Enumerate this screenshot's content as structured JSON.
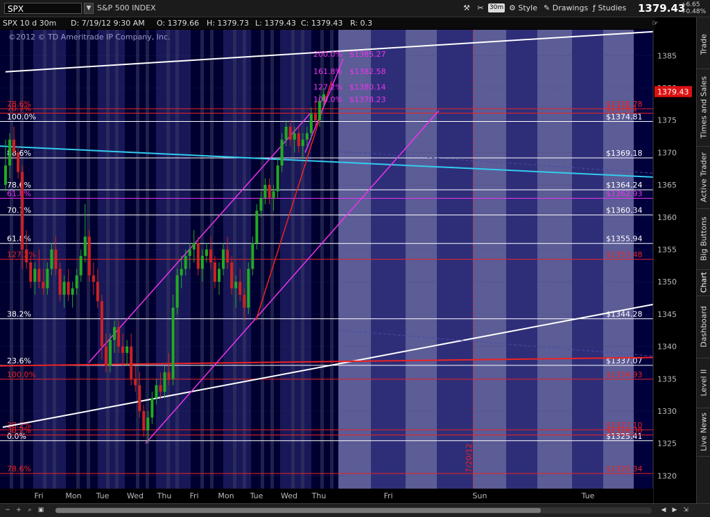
{
  "topbar": {
    "symbol": "SPX",
    "symbol_dropdown_icon": "chevron-down-icon",
    "instrument_name": "S&P 500 INDEX",
    "aggregation": "30m",
    "style_label": "Style",
    "drawings_label": "Drawings",
    "studies_label": "Studies",
    "last_price": "1379.43",
    "change_abs": "+6.65",
    "change_pct": "+0.48%"
  },
  "infobar": {
    "title": "SPX 10 d 30m",
    "date": "D: 7/19/12 9:30 AM",
    "open": "O: 1379.66",
    "high": "H: 1379.73",
    "low": "L: 1379.43",
    "close": "C: 1379.43",
    "range": "R: 0.3",
    "copyright": "©2012 © TD Ameritrade IP Company, Inc."
  },
  "right_tabs": [
    "Trade",
    "Times and Sales",
    "Active Trader",
    "Big Buttons",
    "Chart",
    "Dashboard",
    "Level II",
    "Live News"
  ],
  "colors": {
    "background": "#00003c",
    "band_dark": "#000030",
    "band_light": "#181858",
    "future_dark": "#2e2e78",
    "future_light": "#5c5c96",
    "up": "#22aa22",
    "down": "#cc2222",
    "white_line": "#ffffff",
    "magenta": "#ee33ee",
    "red": "#ee2222",
    "cyan": "#33ccee",
    "price_tag_bg": "#dd1111"
  },
  "chart_data": {
    "type": "candlestick",
    "timeframe": "30m",
    "ylim": [
      1318,
      1389
    ],
    "y_ticks": [
      1320,
      1325,
      1330,
      1335,
      1340,
      1345,
      1350,
      1355,
      1360,
      1365,
      1370,
      1375,
      1380,
      1385
    ],
    "x_labels": [
      "Fri",
      "Mon",
      "Tue",
      "Wed",
      "Thu",
      "Fri",
      "Mon",
      "Tue",
      "Wed",
      "Thu",
      "Fri",
      "Sun",
      "Tue"
    ],
    "date_marker": "7/20/12",
    "last_price_tag": "1379.43",
    "candles": [
      {
        "o": 1365,
        "h": 1372,
        "l": 1364,
        "c": 1368
      },
      {
        "o": 1368,
        "h": 1373,
        "l": 1366,
        "c": 1372
      },
      {
        "o": 1372,
        "h": 1374,
        "l": 1369,
        "c": 1370
      },
      {
        "o": 1370,
        "h": 1371,
        "l": 1366,
        "c": 1367
      },
      {
        "o": 1367,
        "h": 1368,
        "l": 1352,
        "c": 1355
      },
      {
        "o": 1355,
        "h": 1358,
        "l": 1352,
        "c": 1353
      },
      {
        "o": 1353,
        "h": 1354,
        "l": 1349,
        "c": 1350
      },
      {
        "o": 1350,
        "h": 1353,
        "l": 1348,
        "c": 1352
      },
      {
        "o": 1352,
        "h": 1355,
        "l": 1349,
        "c": 1350
      },
      {
        "o": 1350,
        "h": 1352,
        "l": 1348,
        "c": 1349
      },
      {
        "o": 1349,
        "h": 1353,
        "l": 1348,
        "c": 1352
      },
      {
        "o": 1352,
        "h": 1356,
        "l": 1351,
        "c": 1355
      },
      {
        "o": 1355,
        "h": 1357,
        "l": 1351,
        "c": 1352
      },
      {
        "o": 1352,
        "h": 1353,
        "l": 1347,
        "c": 1348
      },
      {
        "o": 1348,
        "h": 1351,
        "l": 1346,
        "c": 1350
      },
      {
        "o": 1350,
        "h": 1352,
        "l": 1347,
        "c": 1348
      },
      {
        "o": 1348,
        "h": 1350,
        "l": 1346,
        "c": 1349
      },
      {
        "o": 1349,
        "h": 1352,
        "l": 1348,
        "c": 1351
      },
      {
        "o": 1351,
        "h": 1355,
        "l": 1350,
        "c": 1354
      },
      {
        "o": 1354,
        "h": 1362,
        "l": 1353,
        "c": 1357
      },
      {
        "o": 1357,
        "h": 1358,
        "l": 1350,
        "c": 1351
      },
      {
        "o": 1351,
        "h": 1353,
        "l": 1348,
        "c": 1350
      },
      {
        "o": 1350,
        "h": 1352,
        "l": 1346,
        "c": 1347
      },
      {
        "o": 1347,
        "h": 1348,
        "l": 1338,
        "c": 1340
      },
      {
        "o": 1340,
        "h": 1342,
        "l": 1336,
        "c": 1337
      },
      {
        "o": 1337,
        "h": 1342,
        "l": 1336,
        "c": 1341
      },
      {
        "o": 1341,
        "h": 1344,
        "l": 1339,
        "c": 1343
      },
      {
        "o": 1343,
        "h": 1344,
        "l": 1339,
        "c": 1340
      },
      {
        "o": 1340,
        "h": 1342,
        "l": 1337,
        "c": 1339
      },
      {
        "o": 1339,
        "h": 1341,
        "l": 1337,
        "c": 1340
      },
      {
        "o": 1340,
        "h": 1342,
        "l": 1334,
        "c": 1335
      },
      {
        "o": 1335,
        "h": 1337,
        "l": 1333,
        "c": 1334
      },
      {
        "o": 1334,
        "h": 1336,
        "l": 1329,
        "c": 1330
      },
      {
        "o": 1330,
        "h": 1331,
        "l": 1326,
        "c": 1327
      },
      {
        "o": 1327,
        "h": 1330,
        "l": 1325,
        "c": 1329
      },
      {
        "o": 1329,
        "h": 1333,
        "l": 1328,
        "c": 1332
      },
      {
        "o": 1332,
        "h": 1335,
        "l": 1331,
        "c": 1334
      },
      {
        "o": 1334,
        "h": 1336,
        "l": 1332,
        "c": 1333
      },
      {
        "o": 1333,
        "h": 1337,
        "l": 1332,
        "c": 1336
      },
      {
        "o": 1336,
        "h": 1339,
        "l": 1334,
        "c": 1335
      },
      {
        "o": 1335,
        "h": 1348,
        "l": 1334,
        "c": 1346
      },
      {
        "o": 1346,
        "h": 1352,
        "l": 1345,
        "c": 1351
      },
      {
        "o": 1351,
        "h": 1354,
        "l": 1349,
        "c": 1352
      },
      {
        "o": 1352,
        "h": 1355,
        "l": 1351,
        "c": 1354
      },
      {
        "o": 1354,
        "h": 1356,
        "l": 1352,
        "c": 1355
      },
      {
        "o": 1355,
        "h": 1358,
        "l": 1353,
        "c": 1356
      },
      {
        "o": 1356,
        "h": 1357,
        "l": 1351,
        "c": 1352
      },
      {
        "o": 1352,
        "h": 1355,
        "l": 1350,
        "c": 1354
      },
      {
        "o": 1354,
        "h": 1356,
        "l": 1353,
        "c": 1355
      },
      {
        "o": 1355,
        "h": 1357,
        "l": 1352,
        "c": 1353
      },
      {
        "o": 1353,
        "h": 1354,
        "l": 1349,
        "c": 1350
      },
      {
        "o": 1350,
        "h": 1353,
        "l": 1348,
        "c": 1352
      },
      {
        "o": 1352,
        "h": 1356,
        "l": 1351,
        "c": 1355
      },
      {
        "o": 1355,
        "h": 1357,
        "l": 1352,
        "c": 1353
      },
      {
        "o": 1353,
        "h": 1354,
        "l": 1348,
        "c": 1349
      },
      {
        "o": 1349,
        "h": 1351,
        "l": 1346,
        "c": 1350
      },
      {
        "o": 1350,
        "h": 1352,
        "l": 1347,
        "c": 1348
      },
      {
        "o": 1348,
        "h": 1349,
        "l": 1344,
        "c": 1346
      },
      {
        "o": 1346,
        "h": 1353,
        "l": 1345,
        "c": 1352
      },
      {
        "o": 1352,
        "h": 1357,
        "l": 1351,
        "c": 1356
      },
      {
        "o": 1356,
        "h": 1362,
        "l": 1355,
        "c": 1361
      },
      {
        "o": 1361,
        "h": 1364,
        "l": 1360,
        "c": 1363
      },
      {
        "o": 1363,
        "h": 1366,
        "l": 1362,
        "c": 1365
      },
      {
        "o": 1365,
        "h": 1366,
        "l": 1362,
        "c": 1363
      },
      {
        "o": 1363,
        "h": 1365,
        "l": 1361,
        "c": 1364
      },
      {
        "o": 1364,
        "h": 1369,
        "l": 1363,
        "c": 1368
      },
      {
        "o": 1368,
        "h": 1373,
        "l": 1367,
        "c": 1372
      },
      {
        "o": 1372,
        "h": 1375,
        "l": 1371,
        "c": 1374
      },
      {
        "o": 1374,
        "h": 1375,
        "l": 1371,
        "c": 1372
      },
      {
        "o": 1372,
        "h": 1374,
        "l": 1370,
        "c": 1373
      },
      {
        "o": 1373,
        "h": 1374,
        "l": 1370,
        "c": 1371
      },
      {
        "o": 1371,
        "h": 1373,
        "l": 1369,
        "c": 1372
      },
      {
        "o": 1372,
        "h": 1374,
        "l": 1371,
        "c": 1373
      },
      {
        "o": 1373,
        "h": 1377,
        "l": 1372,
        "c": 1376
      },
      {
        "o": 1376,
        "h": 1378,
        "l": 1374,
        "c": 1375
      },
      {
        "o": 1375,
        "h": 1379,
        "l": 1374,
        "c": 1378
      },
      {
        "o": 1378,
        "h": 1380,
        "l": 1377,
        "c": 1379
      }
    ],
    "horizontal_levels": [
      {
        "price": 1374.81,
        "color": "white",
        "right_label": "$1374.81",
        "left_label": "100.0%"
      },
      {
        "price": 1369.18,
        "color": "white",
        "right_label": "$1369.18",
        "left_label": "88.6%"
      },
      {
        "price": 1364.24,
        "color": "white",
        "right_label": "$1364.24",
        "left_label": "78.6%"
      },
      {
        "price": 1360.34,
        "color": "white",
        "right_label": "$1360.34",
        "left_label": "70.7%"
      },
      {
        "price": 1355.94,
        "color": "white",
        "right_label": "$1355.94",
        "left_label": "61.8%"
      },
      {
        "price": 1344.28,
        "color": "white",
        "right_label": "$1344.28",
        "left_label": "38.2%"
      },
      {
        "price": 1337.07,
        "color": "white",
        "right_label": "$1337.07",
        "left_label": "23.6%"
      },
      {
        "price": 1325.41,
        "color": "white",
        "right_label": "$1325.41",
        "left_label": "0.0%"
      },
      {
        "price": 1376.78,
        "color": "red",
        "right_label": "$1376.78",
        "left_label": "78.6%"
      },
      {
        "price": 1376.1,
        "color": "red",
        "right_label": "$1376.1",
        "left_label": "70.7%"
      },
      {
        "price": 1362.93,
        "color": "magenta",
        "right_label": "$1362.93",
        "left_label": "61.8%"
      },
      {
        "price": 1353.48,
        "color": "red",
        "right_label": "$1353.48",
        "left_label": "127.2%"
      },
      {
        "price": 1334.93,
        "color": "red",
        "right_label": "$1334.93",
        "left_label": "100.0%"
      },
      {
        "price": 1327.1,
        "color": "red",
        "right_label": "$1327.10",
        "left_label": "38.2%"
      },
      {
        "price": 1326.3,
        "color": "red",
        "right_label": "$1326.30",
        "left_label": "38.2%"
      },
      {
        "price": 1320.34,
        "color": "red",
        "right_label": "$1320.34",
        "left_label": "78.6%"
      }
    ],
    "fib_extensions": [
      {
        "pct": "200.0%",
        "price": "$1385.27",
        "value": 1385.27
      },
      {
        "pct": "161.8%",
        "price": "$1382.58",
        "value": 1382.58
      },
      {
        "pct": "127.2%",
        "price": "$1380.14",
        "value": 1380.14
      },
      {
        "pct": "100.0%",
        "price": "$1378.23",
        "value": 1378.23
      }
    ]
  }
}
